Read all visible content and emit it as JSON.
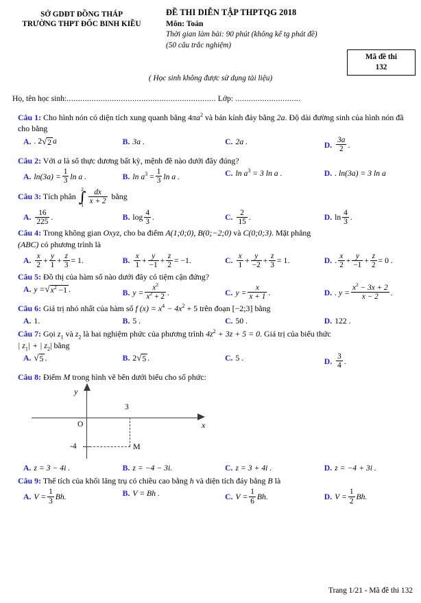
{
  "header": {
    "department": "SỞ GDĐT ĐỒNG THÁP",
    "school": "TRƯỜNG THPT ĐỐC BINH KIỀU",
    "exam_title": "ĐỀ THI DIỄN TẬP THPTQG 2018",
    "subject": "Môn: Toán",
    "time": "Thời gian làm bài: 90 phút (không kể tg phát đề)",
    "question_count": "(50 câu trắc nghiệm)",
    "code_label": "Mã đề thi",
    "code_value": "132",
    "note": "( Học sinh không được sử dụng tài liệu)",
    "name_label": "Họ, tên học sinh:",
    "name_dots": "..................................................................",
    "class_label": "Lớp:",
    "class_dots": "............................."
  },
  "questions": [
    {
      "label": "Câu 1:",
      "stem_1": "Cho hình nón có diện tích xung quanh bằng",
      "stem_m1_num": "4",
      "stem_m1_pi": "π",
      "stem_m1_a": "a",
      "stem_m1_exp": "2",
      "stem_2": "và bán kính đáy bằng",
      "stem_m2": "2a",
      "stem_3": ". Độ dài",
      "stem_4": "đường sinh của hình nón đã cho bằng",
      "options": {
        "a_letter": "A.",
        "a_text": ". 2",
        "a_rad": "2",
        "a_tail": "a",
        "b_letter": "B.",
        "b_text": "3a .",
        "c_letter": "C.",
        "c_text": "2a .",
        "d_letter": "D.",
        "d_num": "3a",
        "d_den": "2",
        "d_tail": "."
      }
    },
    {
      "label": "Câu 2:",
      "stem_1": "Với",
      "stem_var": "a",
      "stem_2": "là số thực dương bất kỳ, mệnh đề nào dưới đây đúng?",
      "options": {
        "a_letter": "A.",
        "a_p1": "ln(3a) =",
        "a_num": "1",
        "a_den": "3",
        "a_p2": "ln a .",
        "b_letter": "B.",
        "b_p1": "ln a",
        "b_exp": "3",
        "b_eq": "=",
        "b_num": "1",
        "b_den": "3",
        "b_p2": "ln a .",
        "c_letter": "C.",
        "c_p1": "ln a",
        "c_exp": "3",
        "c_p2": "= 3 ln a .",
        "d_letter": "D.",
        "d_p1": ". ln(3a) = 3 ln a"
      }
    },
    {
      "label": "Câu 3:",
      "stem_1": "Tích phân",
      "int_upper": "2",
      "int_lower": "1",
      "int_num": "dx",
      "int_den": "x + 2",
      "stem_2": "bằng",
      "options": {
        "a_letter": "A.",
        "a_num": "16",
        "a_den": "225",
        "a_tail": ".",
        "b_letter": "B.",
        "b_pre": "log",
        "b_num": "4",
        "b_den": "3",
        "b_tail": ".",
        "c_letter": "C.",
        "c_num": "2",
        "c_den": "15",
        "c_tail": ".",
        "d_letter": "D.",
        "d_pre": "ln",
        "d_num": "4",
        "d_den": "3",
        "d_tail": "."
      }
    },
    {
      "label": "Câu 4:",
      "stem_1": "Trong không gian",
      "stem_oxyz": "Oxyz",
      "stem_2": ", cho ba điểm",
      "stem_A": "A(1;0;0)",
      "stem_sep1": ",",
      "stem_B": "B(0;−2;0)",
      "stem_and": "và",
      "stem_C": "C(0;0;3)",
      "stem_3": ". Mặt phẳng",
      "stem_4_abc": "(ABC)",
      "stem_4": "có phương trình là",
      "options": {
        "a_letter": "A.",
        "a_d1": "2",
        "a_d2": "1",
        "a_d3": "3",
        "a_eq": "= 1.",
        "b_letter": "B.",
        "b_d1": "1",
        "b_d2": "−1",
        "b_d3": "2",
        "b_eq": "= −1.",
        "c_letter": "C.",
        "c_d1": "1",
        "c_d2": "−2",
        "c_d3": "3",
        "c_eq": "= 1.",
        "d_letter": "D.",
        "d_pre": ".",
        "d_d1": "2",
        "d_d2": "−1",
        "d_d3": "2",
        "d_eq": "= 0 .",
        "nx": "x",
        "ny": "y",
        "nz": "z"
      }
    },
    {
      "label": "Câu 5:",
      "stem": "Đồ thị của hàm số nào dưới đây có tiệm cận đứng?",
      "options": {
        "a_letter": "A.",
        "a_pre": "y =",
        "a_rad_body": "x",
        "a_rad_exp": "2",
        "a_rad_tail": "−1",
        "a_tail": ".",
        "b_letter": "B.",
        "b_pre": "y =",
        "b_num": "x",
        "b_num_exp": "2",
        "b_den": "x",
        "b_den_exp": "2",
        "b_den_tail": "+ 2",
        "b_tail": ".",
        "c_letter": "C.",
        "c_pre": "y =",
        "c_num": "x",
        "c_den": "x + 1",
        "c_tail": ".",
        "d_letter": "D.",
        "d_pre": ". y =",
        "d_num": "x",
        "d_num_exp": "2",
        "d_num_tail": "− 3x + 2",
        "d_den": "x − 2",
        "d_tail": "."
      }
    },
    {
      "label": "Câu 6:",
      "stem_1": "Giá trị nhỏ nhất của hàm số",
      "stem_f": "f (x) = x",
      "stem_f_e1": "4",
      "stem_f2": "− 4x",
      "stem_f_e2": "2",
      "stem_f3": "+ 5",
      "stem_2": "trên đoạn",
      "stem_int": "[−2;3]",
      "stem_3": "bằng",
      "options": {
        "a_letter": "A.",
        "a_text": "1.",
        "b_letter": "B.",
        "b_text": "5 .",
        "c_letter": "C.",
        "c_text": "50 .",
        "d_letter": "D.",
        "d_text": "122 ."
      }
    },
    {
      "label": "Câu 7:",
      "stem_1": "Gọi",
      "stem_z1": "z",
      "stem_z1s": "1",
      "stem_and": "và",
      "stem_z2": "z",
      "stem_z2s": "2",
      "stem_2": "là hai nghiệm phức của phương trình",
      "stem_eq": "4z",
      "stem_eq_exp": "2",
      "stem_eq2": "+ 3z + 5 = 0",
      "stem_3": ". Giá trị của biểu thức",
      "stem_4a": "| z",
      "stem_4a_s": "1",
      "stem_4b": "| + | z",
      "stem_4b_s": "2",
      "stem_4c": "|",
      "stem_5": "bằng",
      "options": {
        "a_letter": "A.",
        "a_rad": "5",
        "a_tail": ".",
        "b_letter": "B.",
        "b_pre": "2",
        "b_rad": "5",
        "b_tail": ".",
        "c_letter": "C.",
        "c_text": "5 .",
        "d_letter": "D.",
        "d_num": "3",
        "d_den": "4",
        "d_tail": "."
      }
    },
    {
      "label": "Câu 8:",
      "stem_1": "Điểm",
      "stem_M": "M",
      "stem_2": "trong hình vẽ bên dưới biểu cho số phức:",
      "figure": {
        "y_axis_label": "y",
        "x_axis_label": "x",
        "origin_label": "O",
        "x_tick_label": "3",
        "y_tick_label": "-4",
        "point_label": "M"
      },
      "options": {
        "a_letter": "A.",
        "a_text": "z = 3 − 4i .",
        "b_letter": "B.",
        "b_text": "z = −4 − 3i.",
        "c_letter": "C.",
        "c_text": "z = 3 + 4i .",
        "d_letter": "D.",
        "d_text": "z = −4 + 3i ."
      }
    },
    {
      "label": "Câu 9:",
      "stem_1": "Thể tích của khối lăng trụ có chiều cao bằng",
      "stem_h": "h",
      "stem_2": "và diện tích đáy bằng",
      "stem_B": "B",
      "stem_3": "là",
      "options": {
        "a_letter": "A.",
        "a_pre": "V =",
        "a_num": "1",
        "a_den": "3",
        "a_post": "Bh.",
        "b_letter": "B.",
        "b_text": "V = Bh .",
        "c_letter": "C.",
        "c_pre": "V =",
        "c_num": "1",
        "c_den": "6",
        "c_post": "Bh.",
        "d_letter": "D.",
        "d_pre": "V =",
        "d_num": "1",
        "d_den": "2",
        "d_post": "Bh."
      }
    }
  ],
  "footer": {
    "text": "Trang 1/21 - Mã đề thi 132"
  }
}
